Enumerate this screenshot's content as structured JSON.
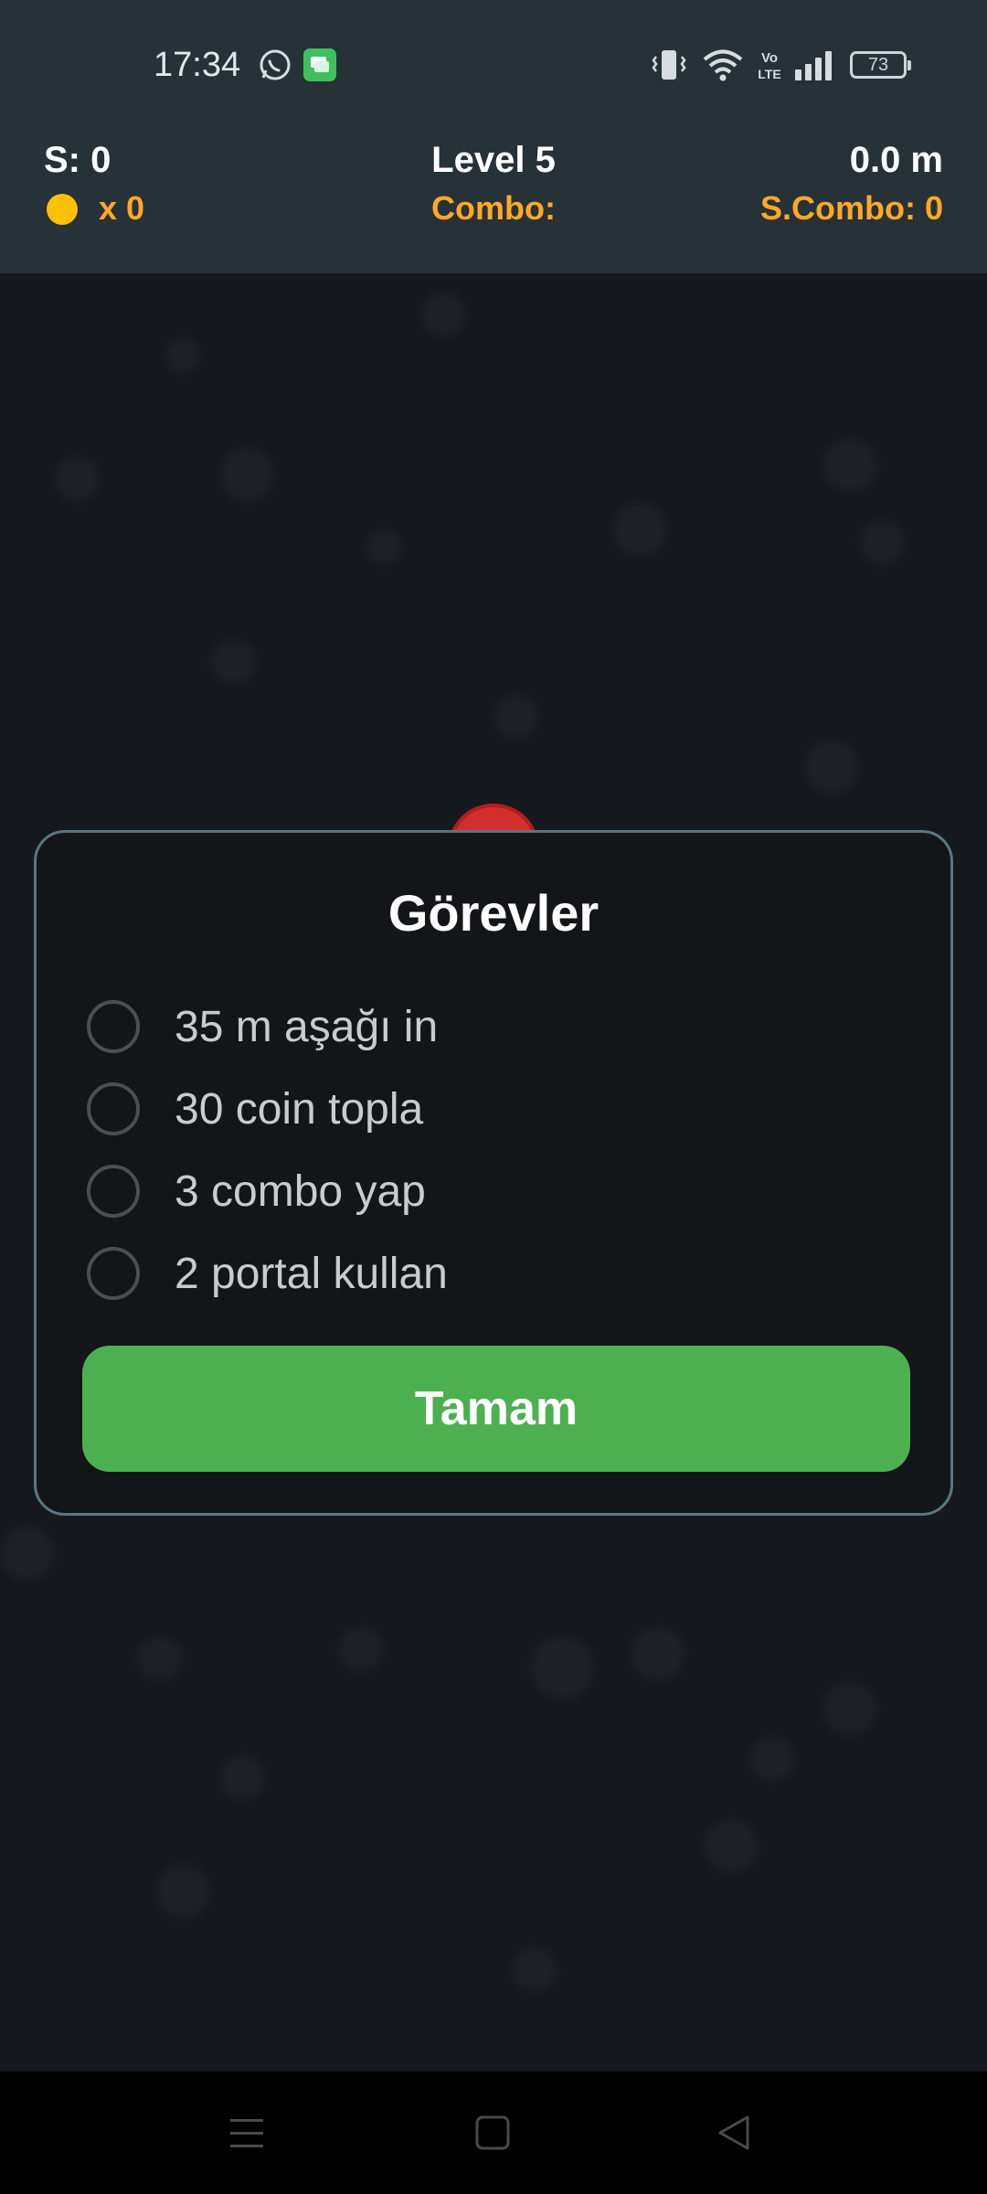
{
  "status_bar": {
    "time": "17:34",
    "battery": "73",
    "icons": [
      "whatsapp-icon",
      "messages-icon",
      "vibrate-icon",
      "wifi-icon",
      "volte-icon",
      "signal-icon",
      "battery-icon"
    ],
    "volte_label": "Vo LTE"
  },
  "hud": {
    "score": "S: 0",
    "coins": "x 0",
    "level": "Level 5",
    "combo": "Combo:",
    "distance": "0.0 m",
    "super_combo": "S.Combo: 0",
    "colors": {
      "background": "#263238",
      "accent": "#ffa726",
      "coin": "#ffc107"
    }
  },
  "dialog": {
    "title": "Görevler",
    "tasks": [
      {
        "label": "35 m aşağı in",
        "done": false
      },
      {
        "label": "30 coin topla",
        "done": false
      },
      {
        "label": "3 combo yap",
        "done": false
      },
      {
        "label": "2 portal kullan",
        "done": false
      }
    ],
    "ok_label": "Tamam",
    "colors": {
      "button": "#4caf50",
      "border": "#5c7582"
    }
  },
  "nav_bar": {
    "buttons": [
      "menu-icon",
      "home-icon",
      "back-icon"
    ]
  }
}
